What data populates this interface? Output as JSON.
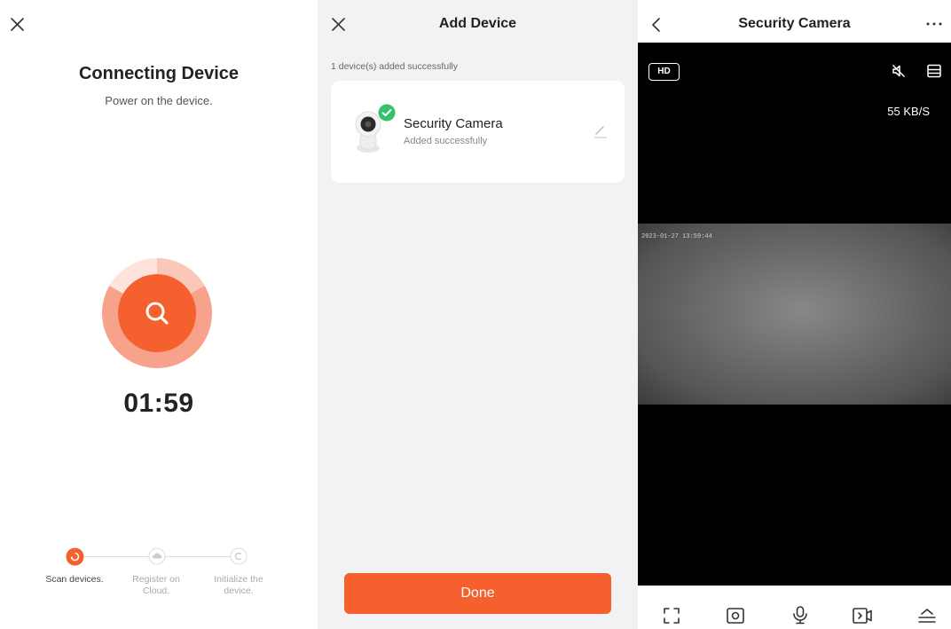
{
  "connecting": {
    "title": "Connecting Device",
    "subtitle": "Power on the device.",
    "timer": "01:59",
    "steps": [
      {
        "label": "Scan devices.",
        "active": true
      },
      {
        "label": "Register on Cloud.",
        "active": false
      },
      {
        "label": "Initialize the device.",
        "active": false
      }
    ],
    "accent": "#f5602e"
  },
  "add_device": {
    "title": "Add Device",
    "success_text": "1 device(s) added successfully",
    "device": {
      "name": "Security Camera",
      "status": "Added successfully"
    },
    "done_label": "Done"
  },
  "camera": {
    "title": "Security Camera",
    "hd_label": "HD",
    "speed": "55 KB/S",
    "timestamp": "2023-01-27 13:59:44"
  }
}
